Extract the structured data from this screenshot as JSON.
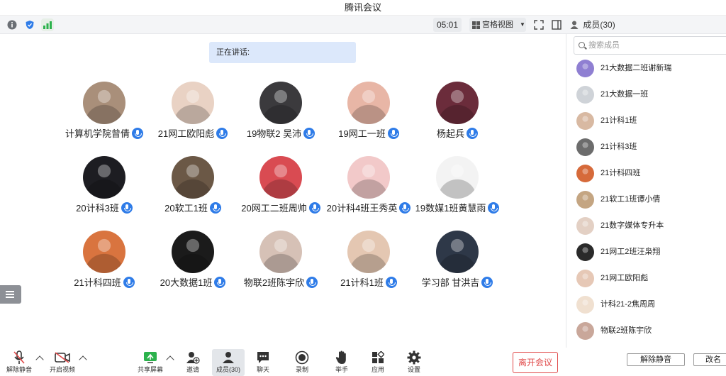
{
  "window": {
    "title": "腾讯会议"
  },
  "toolbar": {
    "timer": "05:01",
    "view_label": "宫格视图",
    "info_icon": "info-icon",
    "shield_icon": "shield-icon",
    "signal_icon": "signal-icon"
  },
  "meeting": {
    "speaking_label": "正在讲话:",
    "participants": [
      {
        "name": "计算机学院曾倩",
        "avatar_color": "#a98f7a"
      },
      {
        "name": "21网工欧阳彪",
        "avatar_color": "#e9d2c4"
      },
      {
        "name": "19物联2  吴沛",
        "avatar_color": "#3b3a3d"
      },
      {
        "name": "19网工一班",
        "avatar_color": "#e8b6a6"
      },
      {
        "name": "杨起兵",
        "avatar_color": "#6b2c3b"
      },
      {
        "name": "20计科3班",
        "avatar_color": "#1d1d22"
      },
      {
        "name": "20软工1班",
        "avatar_color": "#6b5846"
      },
      {
        "name": "20网工二班周帅",
        "avatar_color": "#d94b52"
      },
      {
        "name": "20计科4班王秀英",
        "avatar_color": "#f2c9c9"
      },
      {
        "name": "19数媒1班黄慧雨",
        "avatar_color": "#f3f3f3"
      },
      {
        "name": "21计科四班",
        "avatar_color": "#d9743f"
      },
      {
        "name": "20大数据1班",
        "avatar_color": "#1b1b1b"
      },
      {
        "name": "物联2班陈宇欣",
        "avatar_color": "#d6c1b6"
      },
      {
        "name": "21计科1班",
        "avatar_color": "#e4c7b2"
      },
      {
        "name": "学习部 甘洪吉",
        "avatar_color": "#2e3848"
      }
    ]
  },
  "members_panel": {
    "header": "成员(30)",
    "search_placeholder": "搜索成员",
    "members": [
      {
        "name": "21大数据二班谢新瑞",
        "avatar_color": "#8f7fd2"
      },
      {
        "name": "21大数据一班",
        "avatar_color": "#cfd3d8"
      },
      {
        "name": "21计科1班",
        "avatar_color": "#d8b9a2"
      },
      {
        "name": "21计科3班",
        "avatar_color": "#6c6c6c"
      },
      {
        "name": "21计科四班",
        "avatar_color": "#d66a3a"
      },
      {
        "name": "21软工1班谭小倩",
        "avatar_color": "#c4a582"
      },
      {
        "name": "21数字媒体专升本",
        "avatar_color": "#e3d0c4"
      },
      {
        "name": "21网工2班汪枭翔",
        "avatar_color": "#2a2a2a"
      },
      {
        "name": "21网工欧阳彪",
        "avatar_color": "#e6c8b6"
      },
      {
        "name": "计科21-2焦周周",
        "avatar_color": "#f0e0d0"
      },
      {
        "name": "物联2班陈宇欣",
        "avatar_color": "#c9a79a"
      }
    ],
    "unmute_all": "解除静音",
    "rename": "改名"
  },
  "bottom_bar": {
    "unmute": "解除静音",
    "start_video": "开启视频",
    "share_screen": "共享屏幕",
    "invite": "邀请",
    "members": "成员(30)",
    "chat": "聊天",
    "record": "录制",
    "raise_hand": "举手",
    "apps": "应用",
    "settings": "设置",
    "leave": "离开会议"
  },
  "colors": {
    "accent": "#2f7ce8",
    "leave": "#e04848",
    "speaking_bg": "#dce8fb"
  }
}
